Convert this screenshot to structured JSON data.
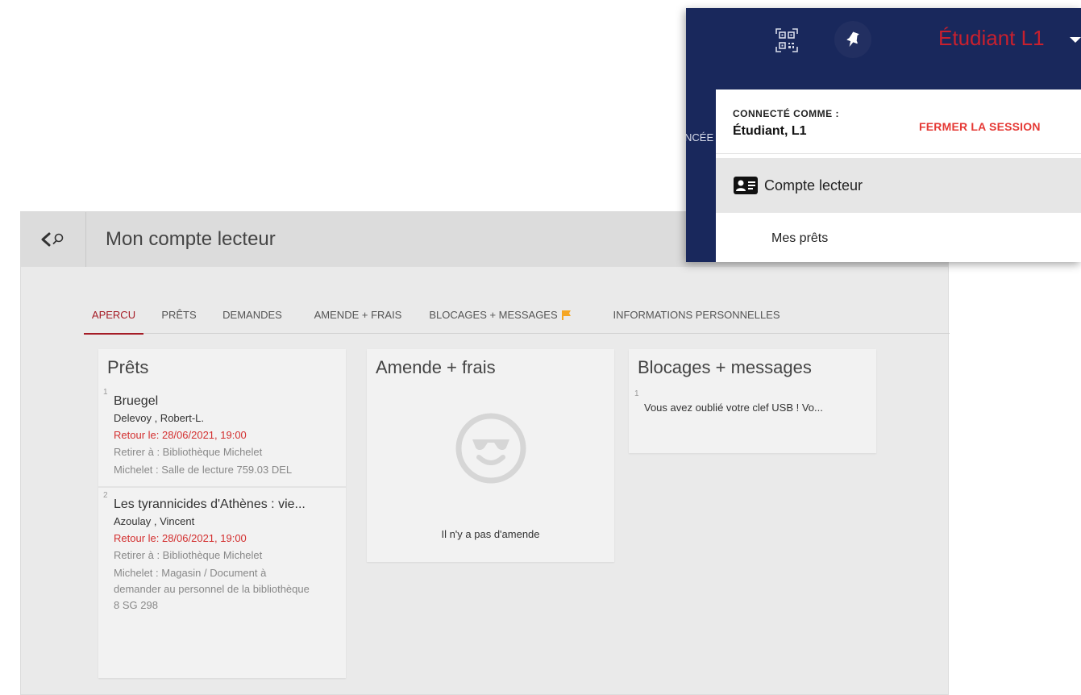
{
  "panel": {
    "title": "Mon compte lecteur",
    "tabs": [
      {
        "label": "APERCU",
        "active": true
      },
      {
        "label": "PRÊTS",
        "active": false
      },
      {
        "label": "DEMANDES",
        "active": false
      },
      {
        "label": "AMENDE + FRAIS",
        "active": false
      },
      {
        "label": "BLOCAGES + MESSAGES",
        "active": false,
        "icon": "flag-icon",
        "icon_color": "#f5a623"
      },
      {
        "label": "INFORMATIONS PERSONNELLES",
        "active": false
      }
    ],
    "loans_card": {
      "title": "Prêts",
      "items": [
        {
          "index": "1",
          "title": "Bruegel",
          "author": "Delevoy , Robert-L.",
          "due": "Retour le: 28/06/2021, 19:00",
          "lines": [
            "Retirer à : Bibliothèque Michelet",
            "Michelet : Salle de lecture 759.03 DEL"
          ]
        },
        {
          "index": "2",
          "title": "Les tyrannicides d'Athènes : vie...",
          "author": "Azoulay , Vincent",
          "due": "Retour le: 28/06/2021, 19:00",
          "lines": [
            "Retirer à : Bibliothèque Michelet",
            "Michelet : Magasin / Document à demander au personnel de la bibliothèque 8 SG 298"
          ]
        }
      ]
    },
    "fines_card": {
      "title": "Amende + frais",
      "icon": "smiley-sunglasses-icon",
      "empty_text": "Il n'y a pas d'amende"
    },
    "blocks_card": {
      "title": "Blocages + messages",
      "items": [
        {
          "index": "1",
          "text": "Vous avez oublié votre clef USB ! Vo..."
        }
      ]
    }
  },
  "user_menu": {
    "user_name": "Étudiant L1",
    "nav_peek": "NCÉE",
    "connected_label": "CONNECTÉ COMME :",
    "connected_name": "Étudiant, L1",
    "logout_label": "FERMER LA SESSION",
    "items": [
      {
        "label": "Compte lecteur",
        "icon": "id-card-icon",
        "active": true
      },
      {
        "label": "Mes prêts",
        "active": false
      }
    ]
  },
  "colors": {
    "accent": "#a51c26",
    "due_red": "#d32f2f",
    "header_navy": "#19285c",
    "logout_red": "#e53935"
  }
}
